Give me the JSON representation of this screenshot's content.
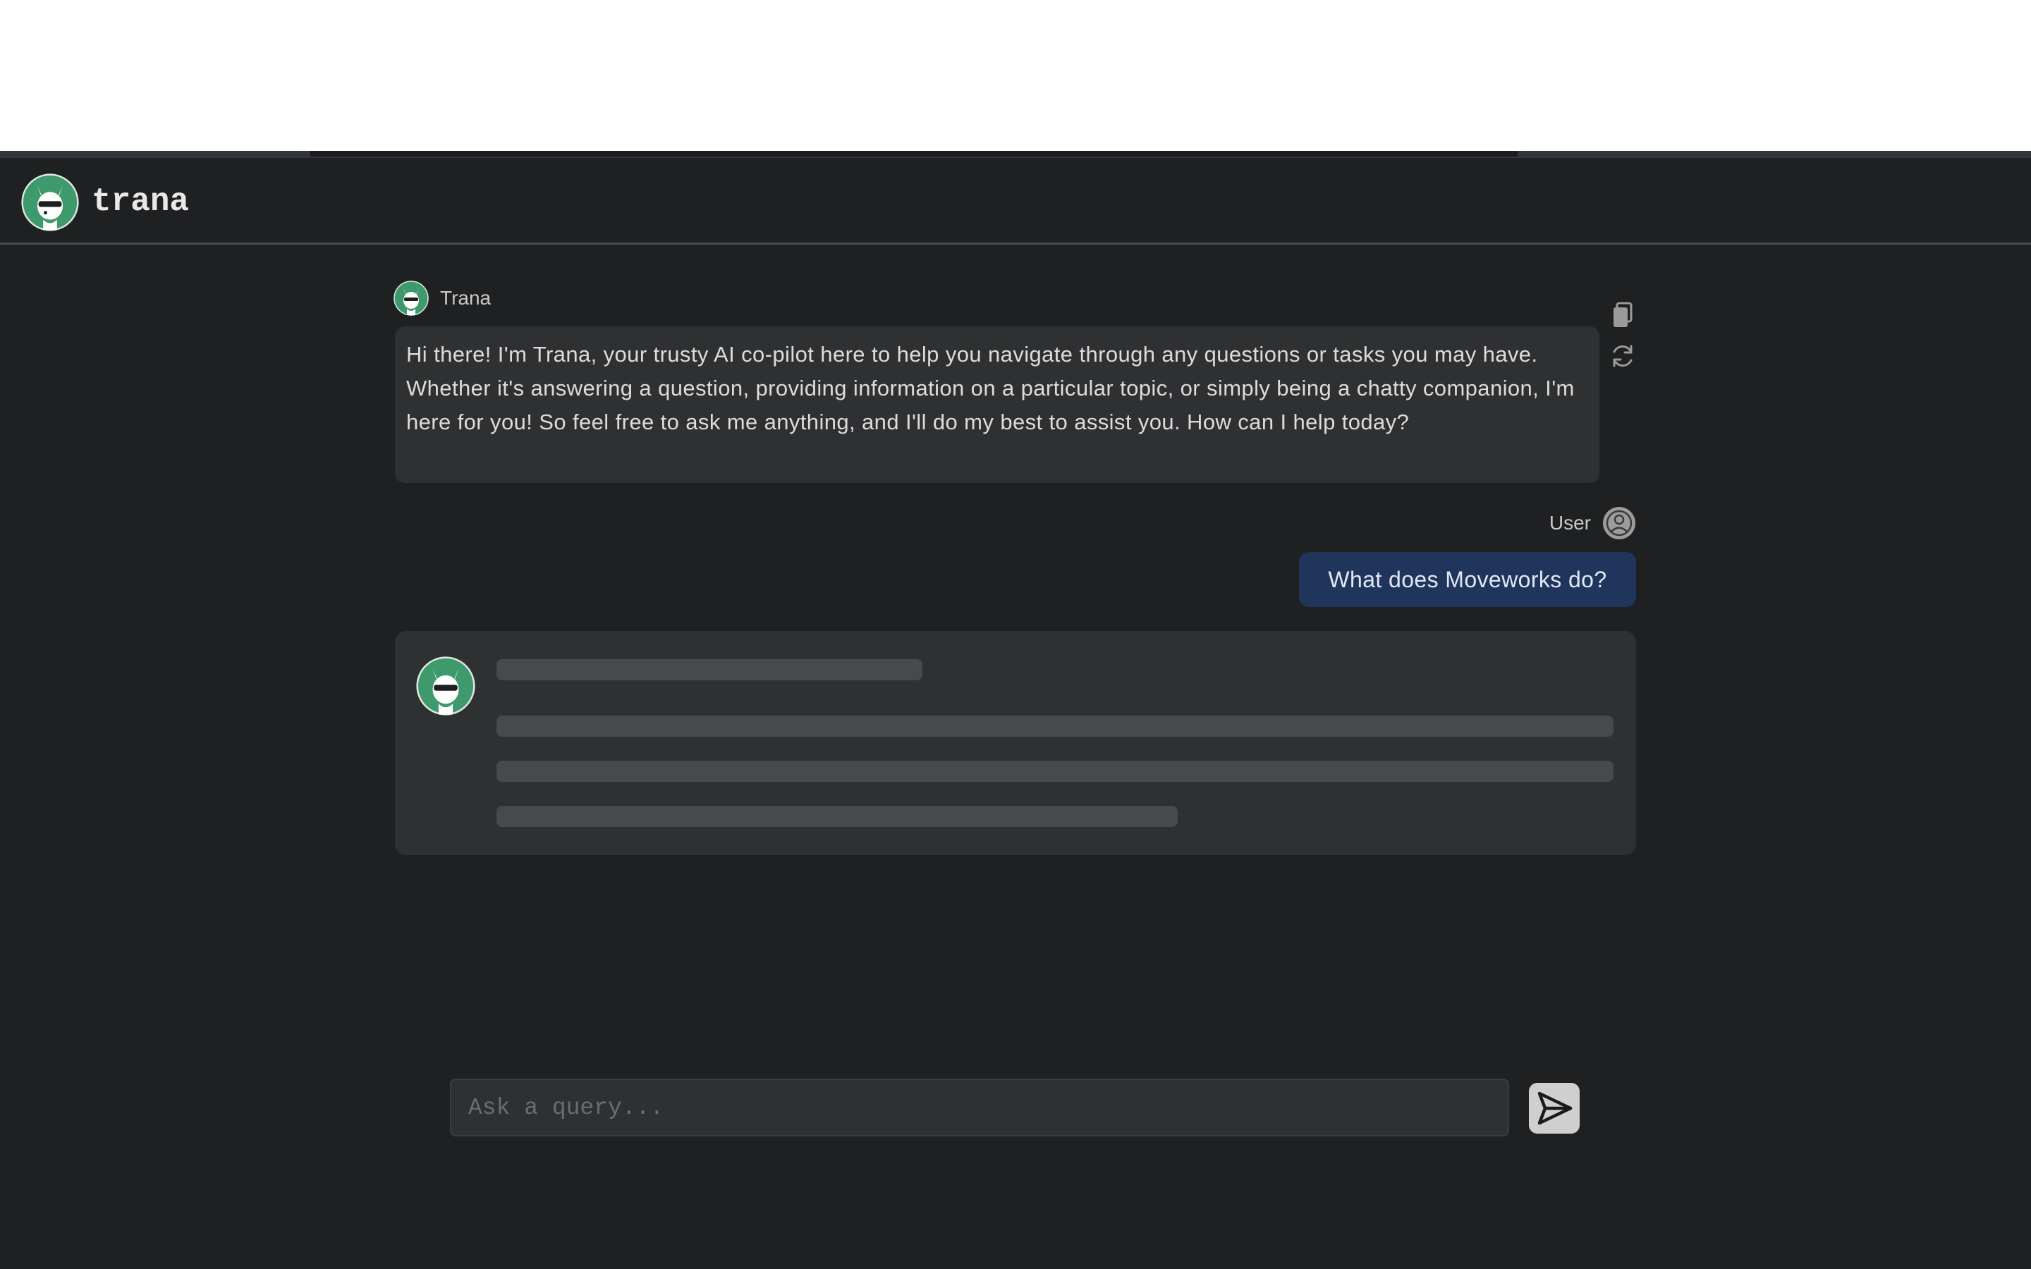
{
  "app": {
    "brand_name": "trana",
    "logo_icon": "llama-logo-icon"
  },
  "colors": {
    "background": "#1f2022",
    "bubble_bot": "#2f3032",
    "bubble_user": "#1f355c",
    "accent_green": "#3e9a6c"
  },
  "messages": {
    "bot": {
      "sender": "Trana",
      "text": " Hi there! I'm Trana, your trusty AI co-pilot here to help you navigate through any questions or tasks you may have. Whether it's answering a question, providing information on a particular topic, or simply being a chatty companion, I'm here for you! So feel free to ask me anything, and I'll do my best to assist you. How can I help today?",
      "actions": {
        "copy_icon": "copy-icon",
        "regenerate_icon": "refresh-icon"
      }
    },
    "user": {
      "sender": "User",
      "text": "What does Moveworks do?",
      "avatar_icon": "user-avatar-icon"
    },
    "pending": {
      "status": "loading"
    }
  },
  "composer": {
    "placeholder": "Ask a query...",
    "value": "",
    "send_icon": "send-icon"
  }
}
